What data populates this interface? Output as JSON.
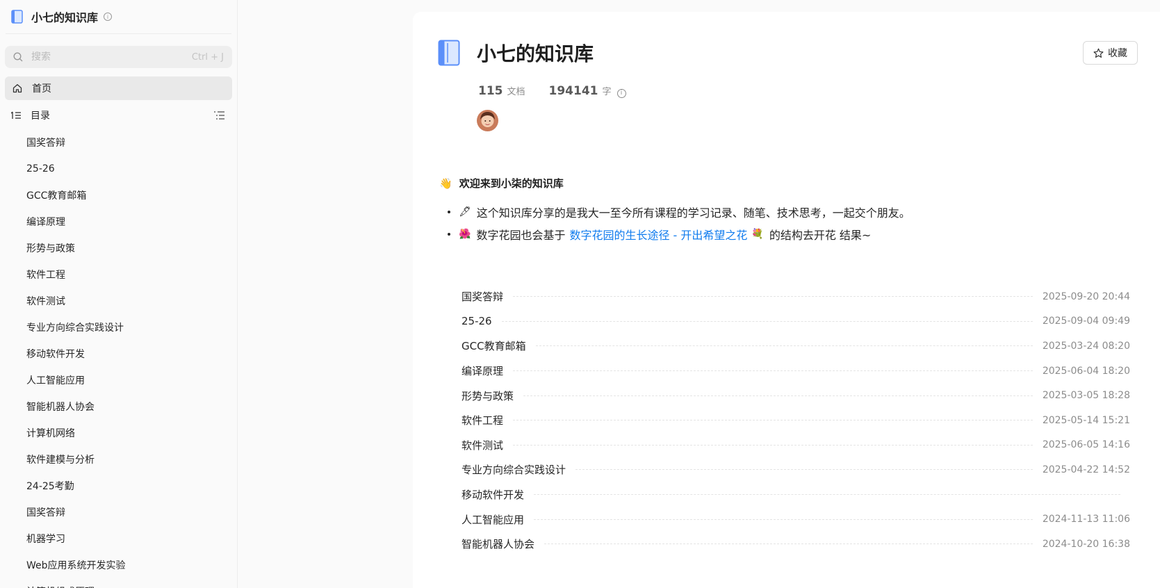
{
  "sidebar": {
    "title": "小七的知识库",
    "search": {
      "placeholder": "搜索",
      "shortcut": "Ctrl + J"
    },
    "home_label": "首页",
    "toc_label": "目录",
    "items": [
      "国奖答辩",
      "25-26",
      "GCC教育邮箱",
      "编译原理",
      "形势与政策",
      "软件工程",
      "软件测试",
      "专业方向综合实践设计",
      "移动软件开发",
      "人工智能应用",
      "智能机器人协会",
      "计算机网络",
      "软件建模与分析",
      "24-25考勤",
      "国奖答辩",
      "机器学习",
      "Web应用系统开发实验",
      "计算机组成原理"
    ]
  },
  "main": {
    "title": "小七的知识库",
    "favorite_label": "收藏",
    "stats": {
      "docs_count": "115",
      "docs_unit": "文档",
      "words_count": "194141",
      "words_unit": "字"
    },
    "welcome": {
      "emoji": "👋",
      "text": "欢迎来到小柒的知识库"
    },
    "bullets": [
      {
        "emoji": "🖋",
        "text": "这个知识库分享的是我大一至今所有课程的学习记录、随笔、技术思考，一起交个朋友。"
      },
      {
        "emoji": "🌺",
        "prefix": "数字花园也会基于",
        "link": "数字花园的生长途径 - 开出希望之花",
        "link_emoji": "💐",
        "suffix": "的结构去开花 结果~"
      }
    ],
    "docs": [
      {
        "title": "国奖答辩",
        "date": "2025-09-20 20:44"
      },
      {
        "title": "25-26",
        "date": "2025-09-04 09:49"
      },
      {
        "title": "GCC教育邮箱",
        "date": "2025-03-24 08:20"
      },
      {
        "title": "编译原理",
        "date": "2025-06-04 18:20"
      },
      {
        "title": "形势与政策",
        "date": "2025-03-05 18:28"
      },
      {
        "title": "软件工程",
        "date": "2025-05-14 15:21"
      },
      {
        "title": "软件测试",
        "date": "2025-06-05 14:16"
      },
      {
        "title": "专业方向综合实践设计",
        "date": "2025-04-22 14:52"
      },
      {
        "title": "移动软件开发",
        "date": ""
      },
      {
        "title": "人工智能应用",
        "date": "2024-11-13 11:06"
      },
      {
        "title": "智能机器人协会",
        "date": "2024-10-20 16:38"
      }
    ]
  },
  "colors": {
    "accent_link": "#117cee",
    "book_icon": "#5b8ff9"
  }
}
